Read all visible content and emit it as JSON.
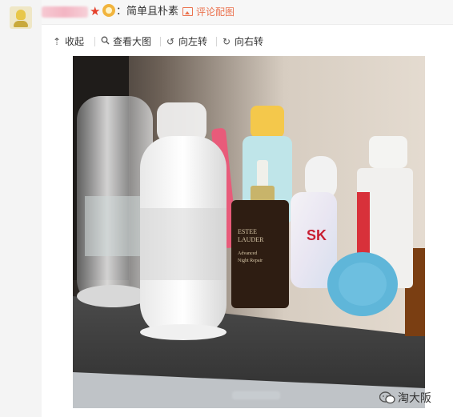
{
  "comment": {
    "text": "：简单且朴素",
    "pic_link": "评论配图"
  },
  "toolbar": {
    "collapse": "收起",
    "view_large": "查看大图",
    "rotate_left": "向左转",
    "rotate_right": "向右转"
  },
  "watermark": {
    "text": "淘大阪"
  },
  "icons": {
    "star": "red-star-icon",
    "badge": "gold-medal-icon",
    "picture": "image-icon",
    "collapse": "arrow-up-icon",
    "view_large": "magnifier-icon",
    "rotate_left": "rotate-left-icon",
    "rotate_right": "rotate-right-icon",
    "wechat": "wechat-icon"
  },
  "colors": {
    "link_orange": "#eb7350",
    "star_red": "#e5402b",
    "wechat_green": "#2aae67"
  }
}
